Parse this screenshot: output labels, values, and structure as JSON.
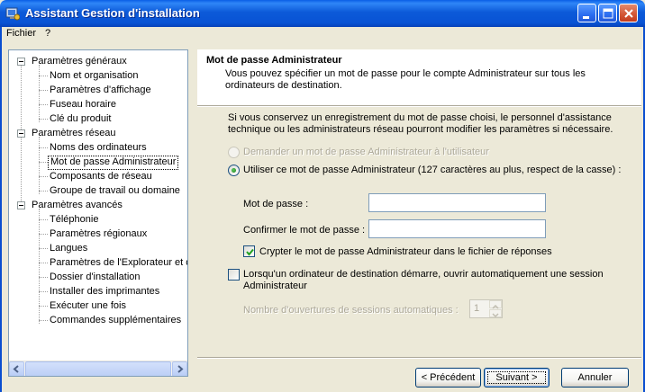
{
  "window": {
    "title": "Assistant Gestion d'installation"
  },
  "menu": {
    "items": [
      "Fichier",
      "?"
    ]
  },
  "tree": {
    "items": [
      {
        "label": "Paramètres généraux",
        "level": 0
      },
      {
        "label": "Nom et organisation",
        "level": 1
      },
      {
        "label": "Paramètres d'affichage",
        "level": 1
      },
      {
        "label": "Fuseau horaire",
        "level": 1
      },
      {
        "label": "Clé du produit",
        "level": 1
      },
      {
        "label": "Paramètres réseau",
        "level": 0
      },
      {
        "label": "Noms des ordinateurs",
        "level": 1
      },
      {
        "label": "Mot de passe Administrateur",
        "level": 1,
        "selected": true
      },
      {
        "label": "Composants de réseau",
        "level": 1
      },
      {
        "label": "Groupe de travail ou domaine",
        "level": 1
      },
      {
        "label": "Paramètres avancés",
        "level": 0
      },
      {
        "label": "Téléphonie",
        "level": 1
      },
      {
        "label": "Paramètres régionaux",
        "level": 1
      },
      {
        "label": "Langues",
        "level": 1
      },
      {
        "label": "Paramètres de l'Explorateur et de",
        "level": 1
      },
      {
        "label": "Dossier d'installation",
        "level": 1
      },
      {
        "label": "Installer des imprimantes",
        "level": 1
      },
      {
        "label": "Exécuter une fois",
        "level": 1
      },
      {
        "label": "Commandes supplémentaires",
        "level": 1
      }
    ]
  },
  "header": {
    "title": "Mot de passe Administrateur",
    "description": "Vous pouvez spécifier un mot de passe pour le compte Administrateur sur tous les ordinateurs de destination."
  },
  "content": {
    "intro": "Si vous conservez un enregistrement du mot de passe choisi, le personnel d'assistance technique ou les administrateurs réseau pourront modifier les paramètres si nécessaire.",
    "radio_prompt": "Demander un mot de passe Administrateur à l'utilisateur",
    "radio_use": "Utiliser ce mot de passe Administrateur (127 caractères au plus, respect de la casse) :",
    "password_label": "Mot de passe :",
    "password_value": "",
    "confirm_label": "Confirmer le mot de passe :",
    "confirm_value": "",
    "encrypt_label": "Crypter le mot de passe Administrateur dans le fichier de réponses",
    "encrypt_checked": true,
    "autologon_label": "Lorsqu'un ordinateur de destination démarre, ouvrir automatiquement une session Administrateur",
    "autologon_checked": false,
    "autologon_count_label": "Nombre d'ouvertures de sessions automatiques :",
    "autologon_count_value": "1"
  },
  "buttons": {
    "previous": "< Précédent",
    "next": "Suivant >",
    "cancel": "Annuler"
  },
  "colors": {
    "titlebar": "#0953d4",
    "dialog_bg": "#ece9d8",
    "radio_dot": "#21a121"
  }
}
